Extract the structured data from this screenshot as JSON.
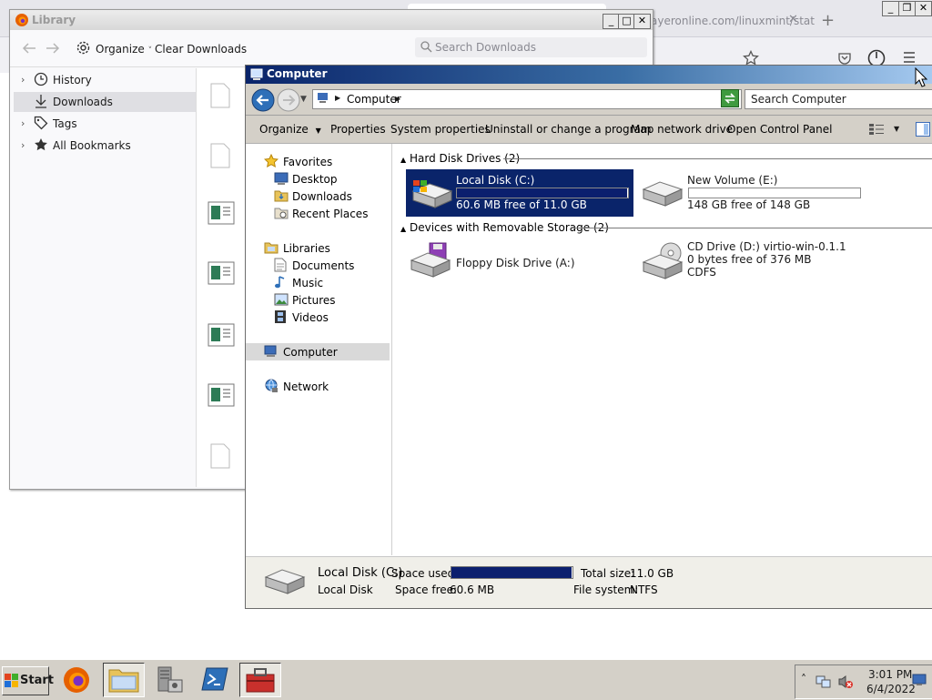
{
  "firefox": {
    "tab_url_fragment": "ayeronline.com/linuxmint/stat",
    "new_tab": "+",
    "tab_close": "✕",
    "win_min": "_",
    "win_max": "❐",
    "win_close": "✕"
  },
  "library": {
    "title": "Library",
    "organize_label": "Organize",
    "clear_downloads_label": "Clear Downloads",
    "search_placeholder": "Search Downloads",
    "tree": [
      {
        "label": "History",
        "icon": "clock-icon",
        "expandable": true
      },
      {
        "label": "Downloads",
        "icon": "download-icon",
        "expandable": false,
        "selected": true
      },
      {
        "label": "Tags",
        "icon": "tag-icon",
        "expandable": true
      },
      {
        "label": "All Bookmarks",
        "icon": "star-icon",
        "expandable": true
      }
    ],
    "win_min": "_",
    "win_max": "□",
    "win_close": "✕"
  },
  "explorer": {
    "title": "Computer",
    "address": "Computer",
    "search_placeholder": "Search Computer",
    "commands": [
      "Organize",
      "Properties",
      "System properties",
      "Uninstall or change a program",
      "Map network drive",
      "Open Control Panel"
    ],
    "nav": {
      "favorites": "Favorites",
      "desktop": "Desktop",
      "downloads": "Downloads",
      "recent_places": "Recent Places",
      "libraries": "Libraries",
      "documents": "Documents",
      "music": "Music",
      "pictures": "Pictures",
      "videos": "Videos",
      "computer": "Computer",
      "network": "Network"
    },
    "groups": {
      "hdd_header": "Hard Disk Drives (2)",
      "removable_header": "Devices with Removable Storage (2)"
    },
    "drives": {
      "c": {
        "name": "Local Disk (C:)",
        "free": "60.6 MB free of 11.0 GB",
        "used_fraction": 0.995
      },
      "e": {
        "name": "New Volume (E:)",
        "free": "148 GB free of 148 GB",
        "used_fraction": 0.0
      },
      "a": {
        "name": "Floppy Disk Drive (A:)"
      },
      "d": {
        "name": "CD Drive (D:) virtio-win-0.1.1",
        "free": "0 bytes free of 376 MB",
        "fs": "CDFS"
      }
    },
    "details": {
      "name": "Local Disk (C:)",
      "type": "Local Disk",
      "space_used_label": "Space used:",
      "space_free_label": "Space free:",
      "space_free": "60.6 MB",
      "total_size_label": "Total size:",
      "total_size": "11.0 GB",
      "file_system_label": "File system:",
      "file_system": "NTFS",
      "used_fraction": 0.995
    }
  },
  "taskbar": {
    "start_label": "Start",
    "clock_time": "3:01 PM",
    "clock_date": "6/4/2022",
    "tray_chevron": "˄"
  },
  "colors": {
    "selection_blue": "#0a246a",
    "bar_fill": "#0b1f6e"
  }
}
